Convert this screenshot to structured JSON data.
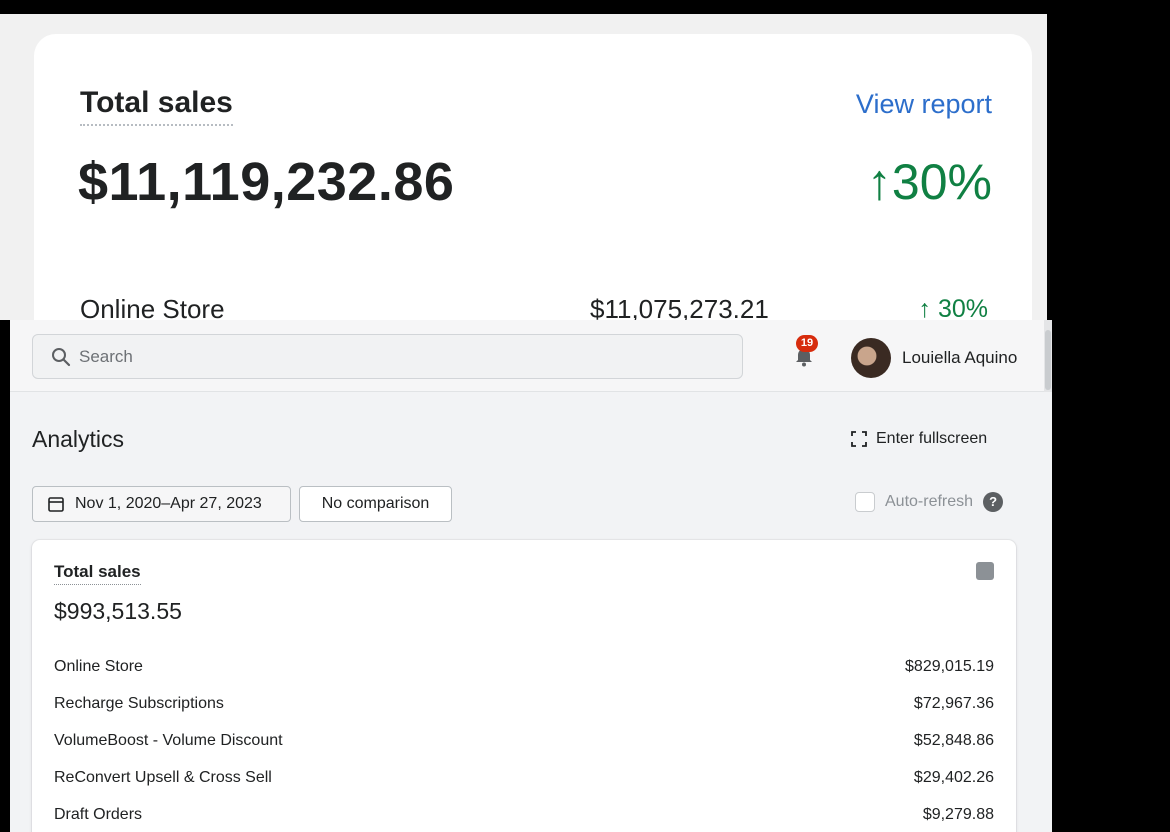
{
  "zoom_card": {
    "title": "Total sales",
    "link": "View report",
    "value": "$11,119,232.86",
    "change": "↑30%",
    "row": {
      "label": "Online Store",
      "value": "$11,075,273.21",
      "change": "↑ 30%"
    }
  },
  "topbar": {
    "search_placeholder": "Search",
    "notification_count": "19",
    "user_name": "Louiella Aquino"
  },
  "page": {
    "title": "Analytics",
    "fullscreen_label": "Enter fullscreen",
    "date_range": "Nov 1, 2020–Apr 27, 2023",
    "comparison": "No comparison",
    "auto_refresh_label": "Auto-refresh",
    "help_glyph": "?"
  },
  "sales_card": {
    "title": "Total sales",
    "value": "$993,513.55",
    "rows": [
      {
        "label": "Online Store",
        "value": "$829,015.19"
      },
      {
        "label": "Recharge Subscriptions",
        "value": "$72,967.36"
      },
      {
        "label": "VolumeBoost - Volume Discount",
        "value": "$52,848.86"
      },
      {
        "label": "ReConvert Upsell & Cross Sell",
        "value": "$29,402.26"
      },
      {
        "label": "Draft Orders",
        "value": "$9,279.88"
      }
    ]
  },
  "colors": {
    "positive_change": "#108043",
    "link": "#2c6ecb",
    "badge": "#d72c0d"
  }
}
